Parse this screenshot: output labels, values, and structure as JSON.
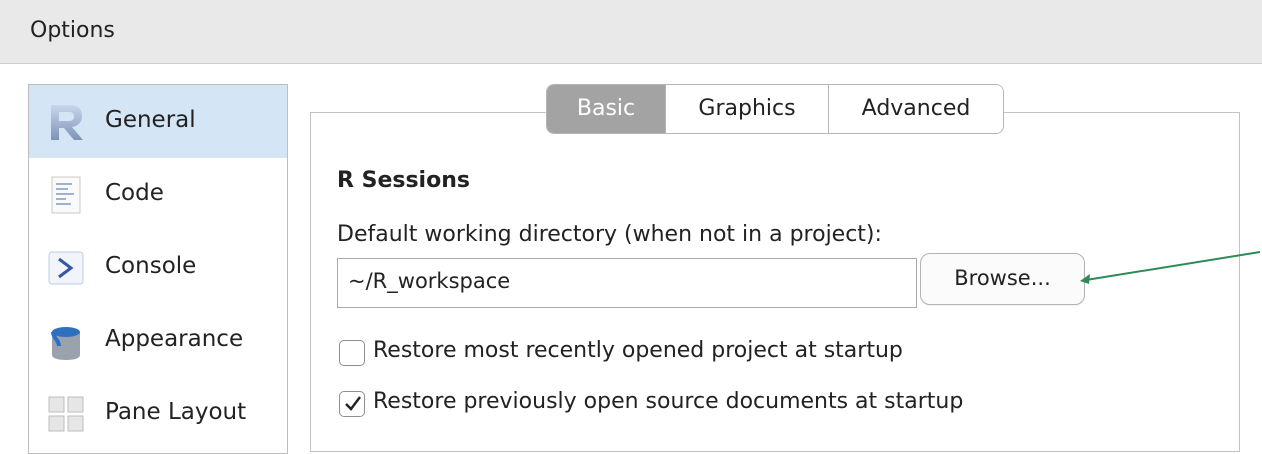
{
  "window": {
    "title": "Options"
  },
  "sidebar": {
    "items": [
      {
        "label": "General",
        "icon": "r-logo-icon",
        "selected": true
      },
      {
        "label": "Code",
        "icon": "code-file-icon",
        "selected": false
      },
      {
        "label": "Console",
        "icon": "console-prompt-icon",
        "selected": false
      },
      {
        "label": "Appearance",
        "icon": "paint-bucket-icon",
        "selected": false
      },
      {
        "label": "Pane Layout",
        "icon": "pane-grid-icon",
        "selected": false
      }
    ]
  },
  "tabs": [
    {
      "label": "Basic",
      "active": true
    },
    {
      "label": "Graphics",
      "active": false
    },
    {
      "label": "Advanced",
      "active": false
    }
  ],
  "sections": {
    "r_sessions": {
      "title": "R Sessions",
      "working_dir_label": "Default working directory (when not in a project):",
      "working_dir_value": "~/R_workspace",
      "browse_label": "Browse...",
      "checkboxes": [
        {
          "label": "Restore most recently opened project at startup",
          "checked": false
        },
        {
          "label": "Restore previously open source documents at startup",
          "checked": true
        }
      ]
    }
  },
  "colors": {
    "selected_item_bg": "#d4e5f6",
    "active_tab_bg": "#a3a3a3",
    "annotation_arrow": "#2e8b57"
  }
}
